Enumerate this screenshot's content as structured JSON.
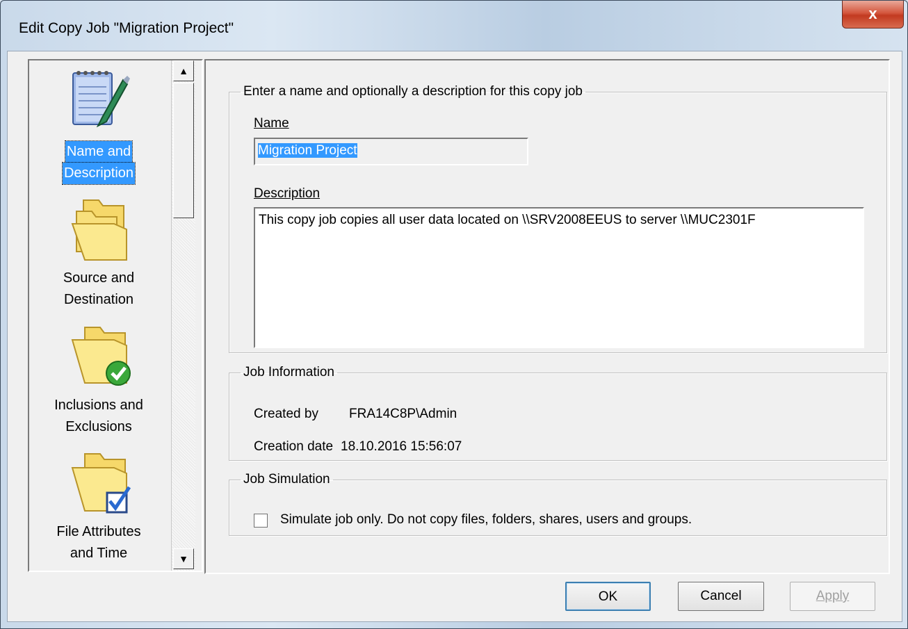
{
  "window": {
    "title": "Edit Copy Job \"Migration Project\"",
    "close_label": "x"
  },
  "sidebar": {
    "items": [
      {
        "label_line1": "Name and",
        "label_line2": "Description",
        "icon": "notepad-pencil-icon",
        "selected": true
      },
      {
        "label_line1": "Source and",
        "label_line2": "Destination",
        "icon": "folders-icon",
        "selected": false
      },
      {
        "label_line1": "Inclusions and",
        "label_line2": "Exclusions",
        "icon": "folder-check-icon",
        "selected": false
      },
      {
        "label_line1": "File Attributes",
        "label_line2": "and Time",
        "icon": "folder-checkbox-icon",
        "selected": false
      }
    ],
    "scroll_up": "▲",
    "scroll_down": "▼"
  },
  "name_group": {
    "legend": "Enter a name and optionally a description for this copy job",
    "name_label": "Name",
    "name_value": "Migration Project",
    "description_label": "Description",
    "description_value": "This copy job copies all user data located on \\\\SRV2008EEUS to server \\\\MUC2301F"
  },
  "job_info": {
    "legend": "Job Information",
    "created_by_label": "Created by",
    "created_by_value": "FRA14C8P\\Admin",
    "creation_date_label": "Creation date",
    "creation_date_value": "18.10.2016 15:56:07"
  },
  "job_sim": {
    "legend": "Job Simulation",
    "checkbox_label": "Simulate job only. Do not copy files, folders, shares, users and groups.",
    "checked": false
  },
  "buttons": {
    "ok": "OK",
    "cancel": "Cancel",
    "apply": "Apply"
  }
}
